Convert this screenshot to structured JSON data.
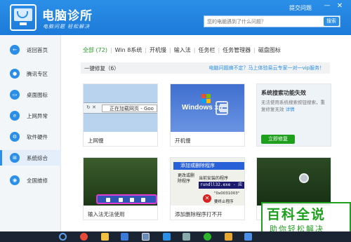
{
  "app": {
    "title": "电脑诊所",
    "slogan": "电脑问题 轻松解决",
    "feedback": "提交问题",
    "minimize_glyph": "—",
    "close_glyph": "✕"
  },
  "search": {
    "placeholder": "您的电脑遇到了什么问题？",
    "button": "搜索"
  },
  "sidebar": {
    "items": [
      {
        "label": "返回首页",
        "icon": "back-arrow-icon"
      },
      {
        "label": "腾讯专区",
        "icon": "penguin-icon"
      },
      {
        "label": "桌面图标",
        "icon": "desktop-icon"
      },
      {
        "label": "上网异常",
        "icon": "ie-icon"
      },
      {
        "label": "软件硬件",
        "icon": "gear-icon"
      },
      {
        "label": "系统综合",
        "icon": "windows-icon"
      },
      {
        "label": "全国维修",
        "icon": "location-icon"
      }
    ],
    "active_index": 5
  },
  "tabs": [
    {
      "label": "全部 (72)",
      "active": true
    },
    {
      "label": "Win 8系统",
      "active": false
    },
    {
      "label": "开机慢",
      "active": false
    },
    {
      "label": "输入法",
      "active": false
    },
    {
      "label": "任务栏",
      "active": false
    },
    {
      "label": "任务管理器",
      "active": false
    },
    {
      "label": "磁盘图标",
      "active": false
    }
  ],
  "section": {
    "title": "一键修复（6）",
    "promo": "电脑问题搞不定？马上体验易云专家一对一vip服务！"
  },
  "cards": [
    {
      "label": "上网慢",
      "image_text": "正在加载网页 - Goo"
    },
    {
      "label": "开机慢",
      "image_text": "Windows xp"
    },
    {
      "title": "系统搜索功能失效",
      "desc": "无法使用系统搜索按钮搜索，重复修复无效",
      "more": "详情",
      "button": "立即修复"
    },
    {
      "label": "输入法无法使用"
    },
    {
      "label": "添加删除程序打不开",
      "dialog_title": "添加或删除程序",
      "dialog_line1": "当前安装的程序",
      "dialog_cmd": "rundll32.exe - 应",
      "dialog_side": "更改或删除程序",
      "dialog_code": "\"0x0031003\"",
      "dialog_code2": "要终止程序"
    }
  ],
  "watermark": {
    "title": "百科全说",
    "subtitle": "助你轻松解决"
  },
  "colors": {
    "brand": "#2b8fe8",
    "accent_green": "#1ea01e"
  }
}
